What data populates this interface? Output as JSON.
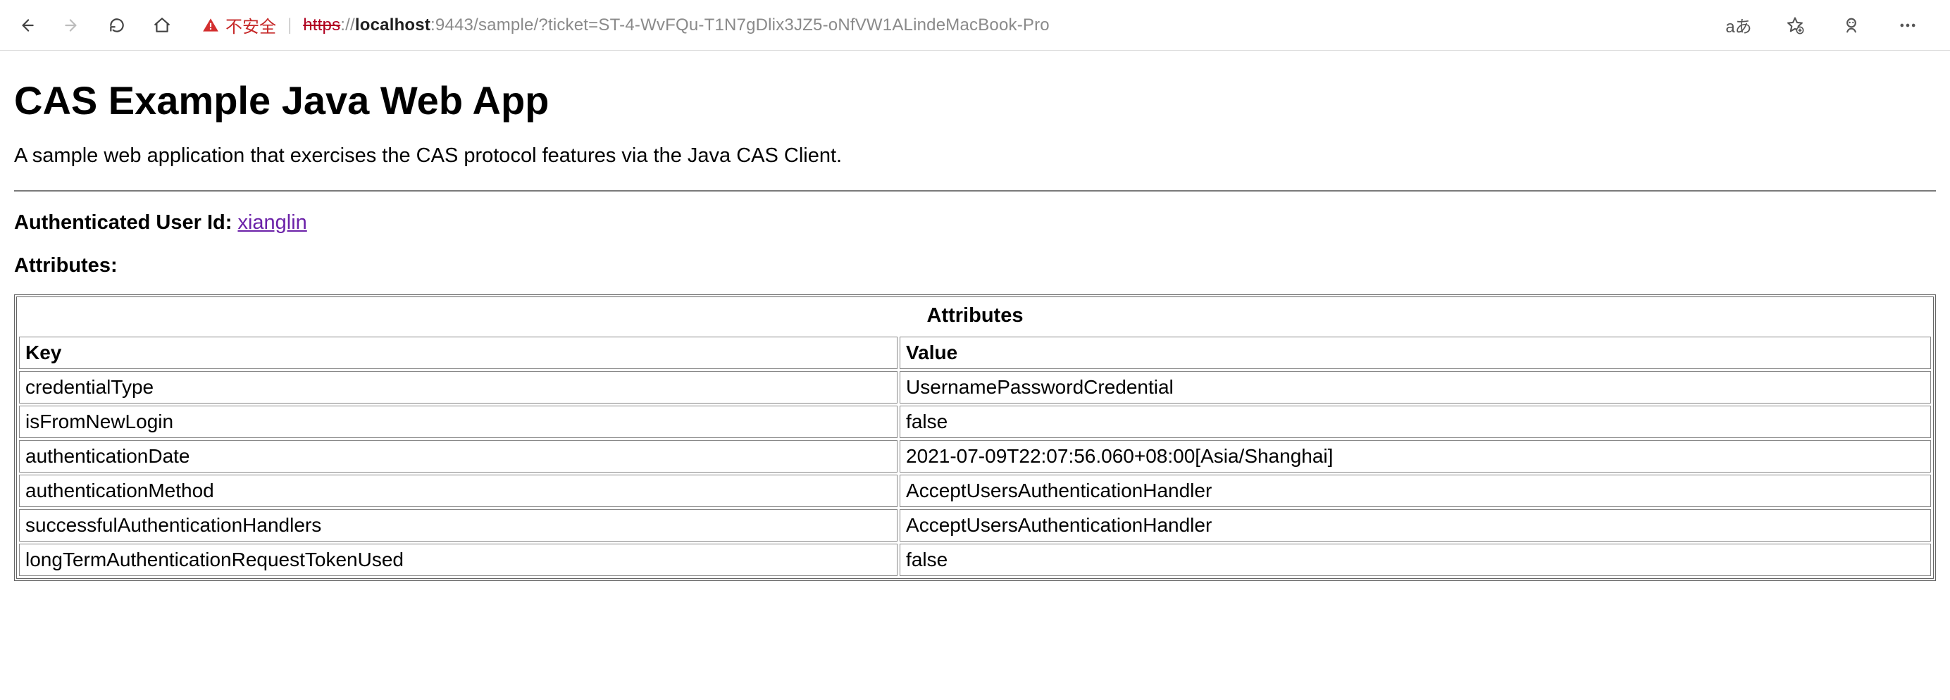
{
  "toolbar": {
    "insecure_label": "不安全",
    "translate_label": "aあ",
    "url": {
      "proto": "https",
      "sep1": "://",
      "host": "localhost",
      "sep2": ":",
      "port": "9443",
      "path_and_query": "/sample/?ticket=ST-4-WvFQu-T1N7gDlix3JZ5-oNfVW1ALindeMacBook-Pro"
    }
  },
  "page": {
    "h1": "CAS Example Java Web App",
    "subtitle": "A sample web application that exercises the CAS protocol features via the Java CAS Client.",
    "auth_user_label": "Authenticated User Id:",
    "auth_user_value": "xianglin",
    "attributes_label": "Attributes:",
    "table_caption": "Attributes",
    "col_key": "Key",
    "col_val": "Value",
    "rows": [
      {
        "key": "credentialType",
        "value": "UsernamePasswordCredential"
      },
      {
        "key": "isFromNewLogin",
        "value": "false"
      },
      {
        "key": "authenticationDate",
        "value": "2021-07-09T22:07:56.060+08:00[Asia/Shanghai]"
      },
      {
        "key": "authenticationMethod",
        "value": "AcceptUsersAuthenticationHandler"
      },
      {
        "key": "successfulAuthenticationHandlers",
        "value": "AcceptUsersAuthenticationHandler"
      },
      {
        "key": "longTermAuthenticationRequestTokenUsed",
        "value": "false"
      }
    ]
  }
}
